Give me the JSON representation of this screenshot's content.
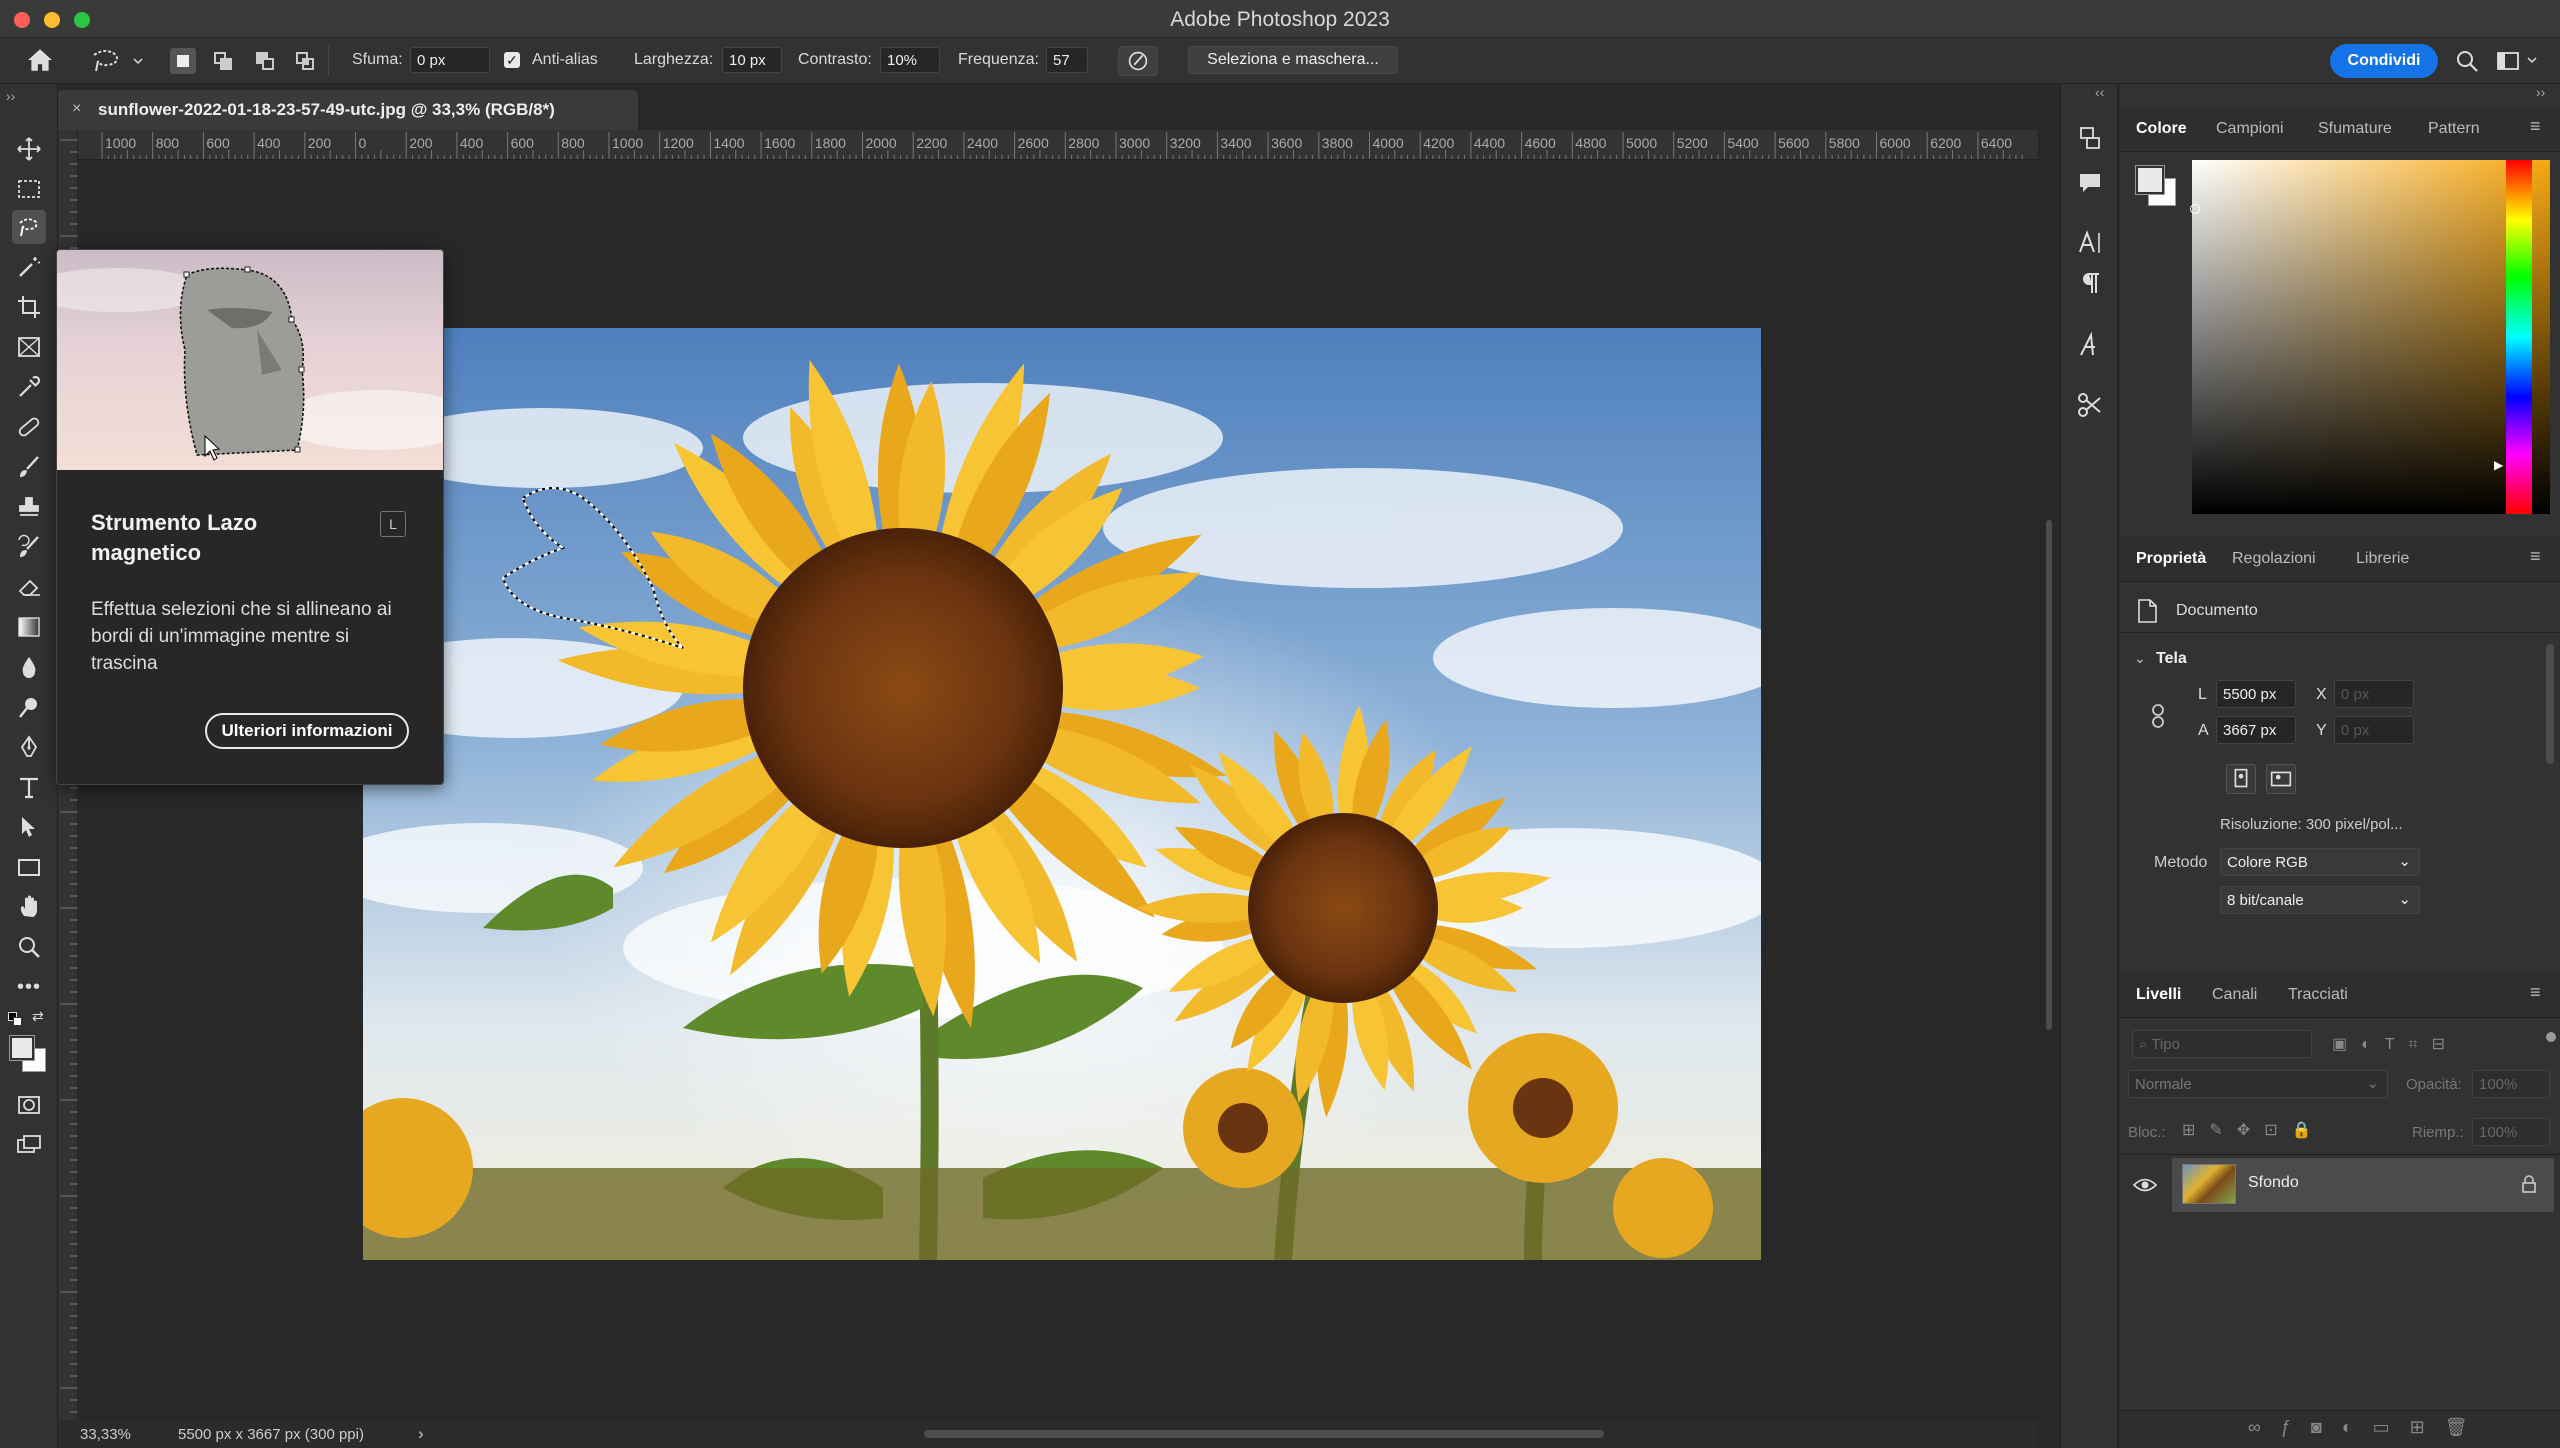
{
  "app": {
    "title": "Adobe Photoshop 2023",
    "share_label": "Condividi"
  },
  "options": {
    "feather_label": "Sfuma:",
    "feather_value": "0 px",
    "antialias_label": "Anti-alias",
    "width_label": "Larghezza:",
    "width_value": "10 px",
    "contrast_label": "Contrasto:",
    "contrast_value": "10%",
    "frequency_label": "Frequenza:",
    "frequency_value": "57",
    "select_mask_label": "Seleziona e maschera..."
  },
  "document": {
    "tab_title": "sunflower-2022-01-18-23-57-49-utc.jpg @ 33,3% (RGB/8*)"
  },
  "ruler": {
    "h_labels": [
      "1000",
      "800",
      "600",
      "400",
      "200",
      "0",
      "200",
      "400",
      "600",
      "800",
      "1000",
      "1200",
      "1400",
      "1600",
      "1800",
      "2000",
      "2200",
      "2400",
      "2600",
      "2800",
      "3000",
      "3200",
      "3400",
      "3600",
      "3800",
      "4000",
      "4200",
      "4400",
      "4600",
      "4800",
      "5000",
      "5200",
      "5400",
      "5600",
      "5800",
      "6000",
      "6200",
      "6400"
    ]
  },
  "tooltip": {
    "title": "Strumento Lazo magnetico",
    "shortcut": "L",
    "description": "Effettua selezioni che si allineano ai bordi di un'immagine mentre si trascina",
    "button": "Ulteriori informazioni"
  },
  "status": {
    "zoom": "33,33%",
    "info": "5500 px x 3667 px (300 ppi)",
    "arrow": "›"
  },
  "color_panel": {
    "tabs": [
      "Colore",
      "Campioni",
      "Sfumature",
      "Pattern"
    ]
  },
  "properties_panel": {
    "tabs": [
      "Proprietà",
      "Regolazioni",
      "Librerie"
    ],
    "doc_label": "Documento",
    "canvas_section": "Tela",
    "w_label": "L",
    "w_value": "5500 px",
    "h_label": "A",
    "h_value": "3667 px",
    "x_label": "X",
    "x_placeholder": "0 px",
    "y_label": "Y",
    "y_placeholder": "0 px",
    "resolution": "Risoluzione: 300 pixel/pol...",
    "mode_label": "Metodo",
    "mode_value": "Colore RGB",
    "depth_value": "8 bit/canale"
  },
  "layers_panel": {
    "tabs": [
      "Livelli",
      "Canali",
      "Tracciati"
    ],
    "search_placeholder": "Tipo",
    "blend_mode": "Normale",
    "opacity_label": "Opacità:",
    "opacity_value": "100%",
    "lock_label": "Bloc.:",
    "fill_label": "Riemp.:",
    "fill_value": "100%",
    "layer_name": "Sfondo"
  },
  "colors": {
    "accent": "#1473e6",
    "panel": "#323232",
    "canvas": "#282828"
  }
}
